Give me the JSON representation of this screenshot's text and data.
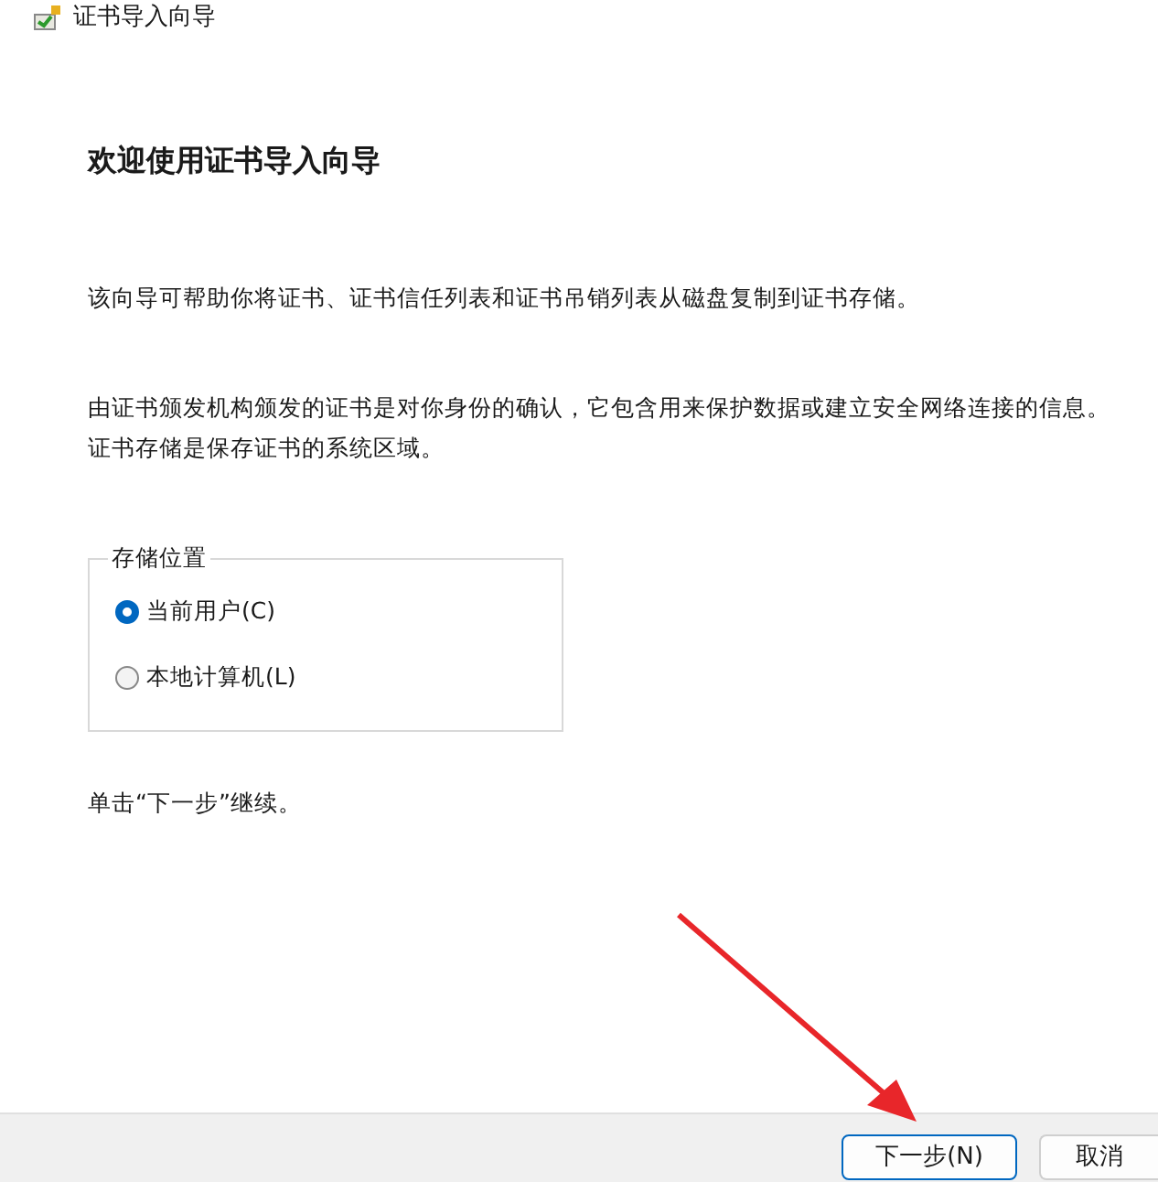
{
  "window": {
    "title": "证书导入向导"
  },
  "heading": "欢迎使用证书导入向导",
  "paragraphs": [
    "该向导可帮助你将证书、证书信任列表和证书吊销列表从磁盘复制到证书存储。",
    "由证书颁发机构颁发的证书是对你身份的确认，它包含用来保护数据或建立安全网络连接的信息。证书存储是保存证书的系统区域。"
  ],
  "store_location": {
    "legend": "存储位置",
    "options": [
      {
        "label": "当前用户(C)",
        "selected": true
      },
      {
        "label": "本地计算机(L)",
        "selected": false
      }
    ]
  },
  "instruction": "单击“下一步”继续。",
  "buttons": [
    {
      "label": "下一步(N)",
      "kind": "primary"
    },
    {
      "label": "取消",
      "kind": "normal"
    }
  ]
}
